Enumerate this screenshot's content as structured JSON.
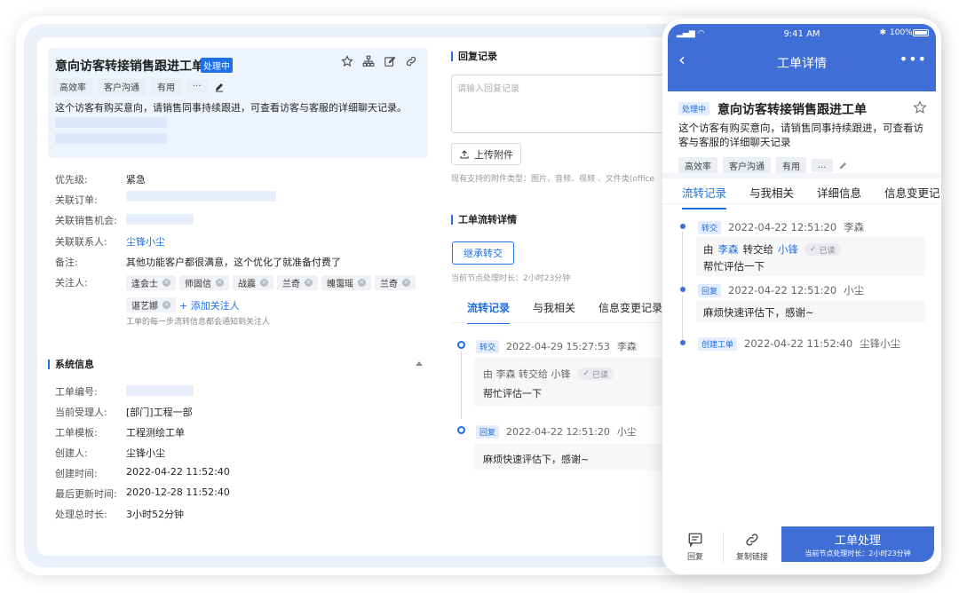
{
  "ticket": {
    "title": "意向访客转接销售跟进工单",
    "status": "处理中",
    "tags": [
      "高效率",
      "客户沟通",
      "有用",
      "···"
    ],
    "description": "这个访客有购买意向，请销售同事持续跟进，可查看访客与客服的详细聊天记录。"
  },
  "fields": {
    "priority_label": "优先级:",
    "priority_value": "紧急",
    "order_label": "关联订单:",
    "opportunity_label": "关联销售机会:",
    "contact_label": "关联联系人:",
    "contact_value": "尘锋小尘",
    "remark_label": "备注:",
    "remark_value": "其他功能客户都很满意，这个优化了就准备付费了",
    "attendees_label": "关注人:",
    "attendees": [
      "逢会士",
      "师固信",
      "战震",
      "兰奇",
      "魄霭瑶",
      "兰奇",
      "谌艺娜"
    ],
    "add_attendee": "+ 添加关注人",
    "attendee_hint": "工单的每一步流转信息都会通知到关注人"
  },
  "system": {
    "section_title": "系统信息",
    "number_label": "工单编号:",
    "assignee_label": "当前受理人:",
    "assignee_value": "[部门]工程一部",
    "template_label": "工单模板:",
    "template_value": "工程测绘工单",
    "creator_label": "创建人:",
    "creator_value": "尘锋小尘",
    "created_label": "创建时间:",
    "created_value": "2022-04-22  11:52:40",
    "updated_label": "最后更新时间:",
    "updated_value": "2020-12-28  11:52:40",
    "duration_label": "处理总时长:",
    "duration_value": "3小时52分钟"
  },
  "reply": {
    "section_title": "回复记录",
    "placeholder": "请输入回复记录",
    "upload_label": "上传附件",
    "upload_hint": "现有支持的附件类型：图片、音频、视频 、文件类(office"
  },
  "flow": {
    "section_title": "工单流转详情",
    "inherit_button": "继承转交",
    "node_time": "当前节点处理时长：2小时23分钟",
    "tabs": [
      "流转记录",
      "与我相关",
      "信息变更记录"
    ],
    "entries": [
      {
        "type": "转交",
        "time": "2022-04-29  15:27:53",
        "user": "李森",
        "line1": "由 李森 转交给 小锋",
        "read": "已读",
        "line2": "帮忙评估一下"
      },
      {
        "type": "回复",
        "time": "2022-04-22  12:51:20",
        "user": "小尘",
        "line1": "麻烦快速评估下，感谢~"
      }
    ]
  },
  "mobile": {
    "status_time": "9:41 AM",
    "battery": "100%",
    "nav_title": "工单详情",
    "more": "•••",
    "status": "处理中",
    "title": "意向访客转接销售跟进工单",
    "description": "这个访客有购买意向，请销售同事持续跟进，可查看访客与客服的详细聊天记录",
    "tags": [
      "高效率",
      "客户沟通",
      "有用",
      "..."
    ],
    "tabs": [
      "流转记录",
      "与我相关",
      "详细信息",
      "信息变更记"
    ],
    "entries": [
      {
        "type": "转交",
        "time": "2022-04-22  12:51:20",
        "user": "李森",
        "from_prefix": "由",
        "from": "李森",
        "mid": "转交给",
        "to": "小锋",
        "read": "已读",
        "note": "帮忙评估一下"
      },
      {
        "type": "回复",
        "time": "2022-04-22  12:51:20",
        "user": "小尘",
        "note": "麻烦快速评估下，感谢~"
      },
      {
        "type": "创建工单",
        "time": "2022-04-22  11:52:40",
        "user": "尘锋小尘"
      }
    ],
    "bottom": {
      "reply": "回复",
      "copy_link": "复制链接",
      "primary": "工单处理",
      "primary_sub": "当前节点处理时长：2小时23分钟"
    }
  },
  "colors": {
    "accent": "#1f6fe5",
    "phone_header": "#3f6ed6",
    "page_bg": "#eaf1fb"
  }
}
